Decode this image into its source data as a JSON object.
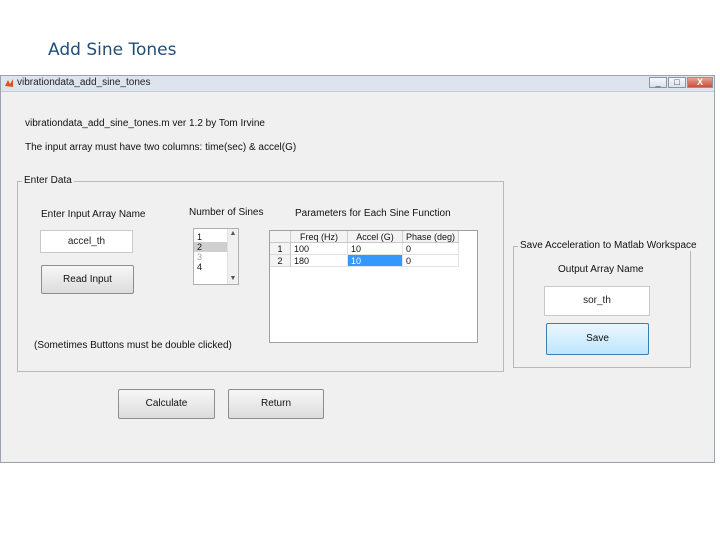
{
  "slide_title": "Add Sine Tones",
  "window": {
    "title": "vibrationdata_add_sine_tones",
    "minimize": "_",
    "maximize": "□",
    "close": "X"
  },
  "header": {
    "line1": "vibrationdata_add_sine_tones.m  ver 1.2  by Tom Irvine",
    "line2": "The input array must have two columns: time(sec) & accel(G)"
  },
  "enter_data": {
    "title": "Enter Data",
    "input_label": "Enter Input Array Name",
    "input_value": "accel_th",
    "read_button": "Read Input",
    "note": "(Sometimes Buttons must be double clicked)",
    "sines_label": "Number of Sines",
    "sines_options": [
      "1",
      "2",
      "3",
      "4"
    ],
    "sines_selected": "2",
    "params_label": "Parameters for Each Sine Function",
    "table": {
      "columns": [
        "Freq (Hz)",
        "Accel (G)",
        "Phase (deg)"
      ],
      "rows": [
        {
          "index": "1",
          "freq": "100",
          "accel": "10",
          "phase": "0"
        },
        {
          "index": "2",
          "freq": "180",
          "accel": "10",
          "phase": "0"
        }
      ]
    }
  },
  "save_panel": {
    "title": "Save Acceleration to Matlab Workspace",
    "output_label": "Output Array Name",
    "output_value": "sor_th",
    "save_button": "Save"
  },
  "buttons": {
    "calculate": "Calculate",
    "return": "Return"
  },
  "colors": {
    "slide_title": "#1f4e79",
    "selected_cell": "#3399ff",
    "window_bg": "#f0f0f0"
  }
}
